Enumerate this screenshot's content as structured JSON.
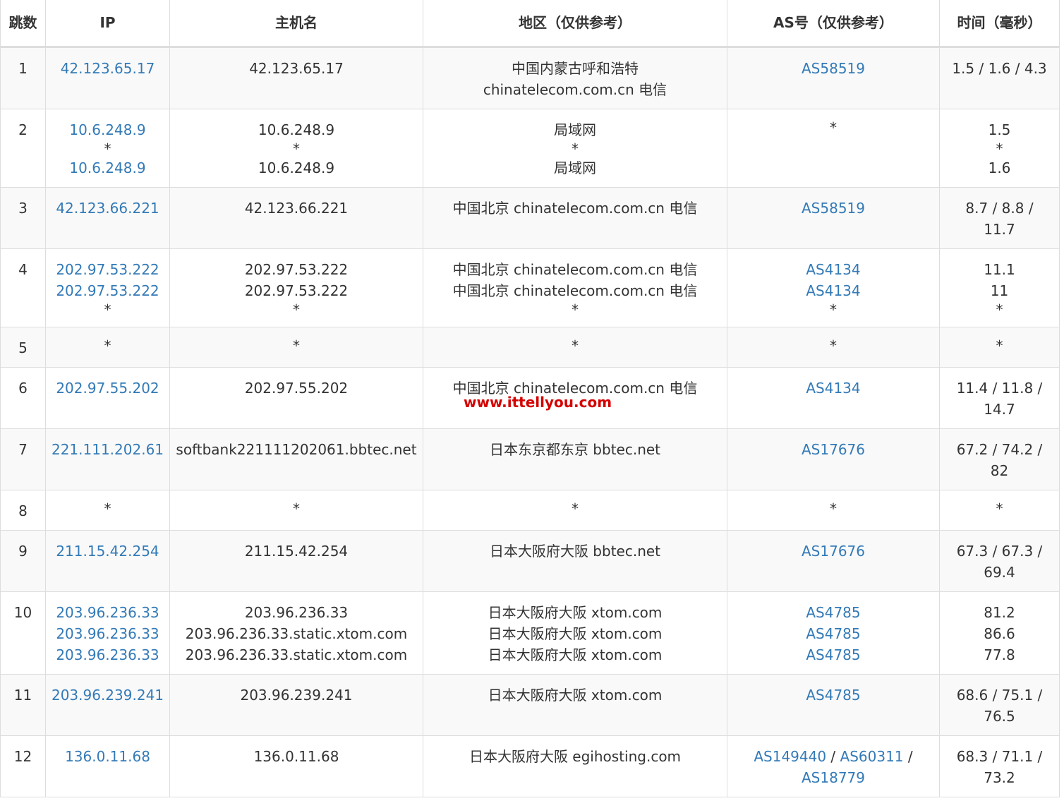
{
  "headers": {
    "hop": "跳数",
    "ip": "IP",
    "hostname": "主机名",
    "region": "地区（仅供参考）",
    "as": "AS号（仅供参考）",
    "time": "时间（毫秒）"
  },
  "rows": [
    {
      "hop": "1",
      "ips": [
        "42.123.65.17"
      ],
      "hosts": [
        "42.123.65.17"
      ],
      "regions": [
        "中国内蒙古呼和浩特",
        "chinatelecom.com.cn 电信"
      ],
      "as": [
        "AS58519"
      ],
      "time": [
        "1.5 / 1.6 / 4.3"
      ]
    },
    {
      "hop": "2",
      "ips": [
        "10.6.248.9",
        "*",
        "10.6.248.9"
      ],
      "hosts": [
        "10.6.248.9",
        "*",
        "10.6.248.9"
      ],
      "regions": [
        "局域网",
        "*",
        "局域网"
      ],
      "as": [
        "*"
      ],
      "time": [
        "1.5",
        "*",
        "1.6"
      ]
    },
    {
      "hop": "3",
      "ips": [
        "42.123.66.221"
      ],
      "hosts": [
        "42.123.66.221"
      ],
      "regions": [
        "中国北京 chinatelecom.com.cn 电信"
      ],
      "as": [
        "AS58519"
      ],
      "time": [
        "8.7 / 8.8 /",
        "11.7"
      ]
    },
    {
      "hop": "4",
      "ips": [
        "202.97.53.222",
        "202.97.53.222",
        "*"
      ],
      "hosts": [
        "202.97.53.222",
        "202.97.53.222",
        "*"
      ],
      "regions": [
        "中国北京 chinatelecom.com.cn 电信",
        "中国北京 chinatelecom.com.cn 电信",
        "*"
      ],
      "as": [
        "AS4134",
        "AS4134",
        "*"
      ],
      "time": [
        "11.1",
        "11",
        "*"
      ]
    },
    {
      "hop": "5",
      "ips": [
        "*"
      ],
      "hosts": [
        "*"
      ],
      "regions": [
        "*"
      ],
      "as": [
        "*"
      ],
      "time": [
        "*"
      ]
    },
    {
      "hop": "6",
      "ips": [
        "202.97.55.202"
      ],
      "hosts": [
        "202.97.55.202"
      ],
      "regions": [
        "中国北京 chinatelecom.com.cn 电信"
      ],
      "as": [
        "AS4134"
      ],
      "time": [
        "11.4 / 11.8 /",
        "14.7"
      ]
    },
    {
      "hop": "7",
      "ips": [
        "221.111.202.61"
      ],
      "hosts": [
        "softbank221111202061.bbtec.net"
      ],
      "regions": [
        "日本东京都东京 bbtec.net"
      ],
      "as": [
        "AS17676"
      ],
      "time": [
        "67.2 / 74.2 /",
        "82"
      ]
    },
    {
      "hop": "8",
      "ips": [
        "*"
      ],
      "hosts": [
        "*"
      ],
      "regions": [
        "*"
      ],
      "as": [
        "*"
      ],
      "time": [
        "*"
      ]
    },
    {
      "hop": "9",
      "ips": [
        "211.15.42.254"
      ],
      "hosts": [
        "211.15.42.254"
      ],
      "regions": [
        "日本大阪府大阪 bbtec.net"
      ],
      "as": [
        "AS17676"
      ],
      "time": [
        "67.3 / 67.3 /",
        "69.4"
      ]
    },
    {
      "hop": "10",
      "ips": [
        "203.96.236.33",
        "203.96.236.33",
        "203.96.236.33"
      ],
      "hosts": [
        "203.96.236.33",
        "203.96.236.33.static.xtom.com",
        "203.96.236.33.static.xtom.com"
      ],
      "regions": [
        "日本大阪府大阪 xtom.com",
        "日本大阪府大阪 xtom.com",
        "日本大阪府大阪 xtom.com"
      ],
      "as": [
        "AS4785",
        "AS4785",
        "AS4785"
      ],
      "time": [
        "81.2",
        "86.6",
        "77.8"
      ]
    },
    {
      "hop": "11",
      "ips": [
        "203.96.239.241"
      ],
      "hosts": [
        "203.96.239.241"
      ],
      "regions": [
        "日本大阪府大阪 xtom.com"
      ],
      "as": [
        "AS4785"
      ],
      "time": [
        "68.6 / 75.1 /",
        "76.5"
      ]
    },
    {
      "hop": "12",
      "ips": [
        "136.0.11.68"
      ],
      "hosts": [
        "136.0.11.68"
      ],
      "regions": [
        "日本大阪府大阪 egihosting.com"
      ],
      "as": [
        "AS149440 / AS60311 /",
        "AS18779"
      ],
      "time": [
        "68.3 / 71.1 /",
        "73.2"
      ]
    }
  ],
  "watermark": "www.ittellyou.com",
  "colors": {
    "link": "#337ab7",
    "stripe": "#f9f9f9",
    "border": "#dddddd",
    "watermark": "#d40000"
  }
}
